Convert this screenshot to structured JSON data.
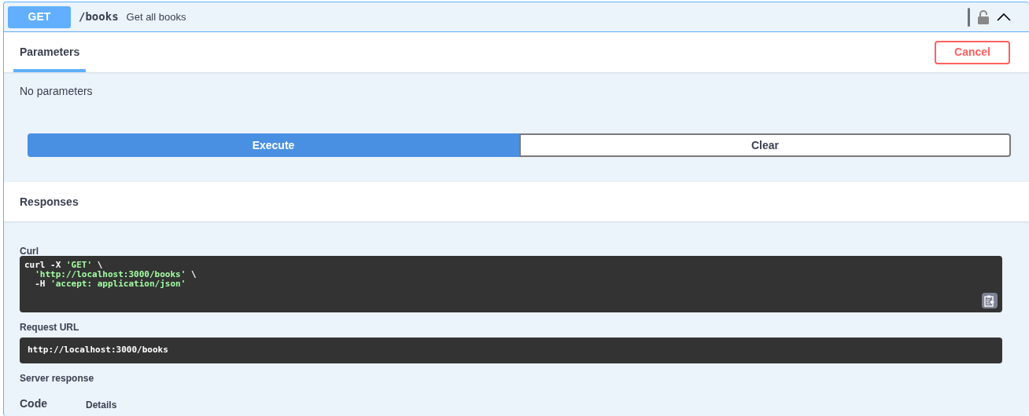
{
  "operation": {
    "method": "GET",
    "path": "/books",
    "summary": "Get all books",
    "expanded": true
  },
  "tabs": [
    {
      "label": "Parameters",
      "selected": true
    }
  ],
  "cancel_button": "Cancel",
  "parameters_message": "No parameters",
  "buttons": [
    {
      "label": "Execute",
      "kind": "primary"
    },
    {
      "label": "Clear",
      "kind": "secondary"
    }
  ],
  "responses": {
    "title": "Responses",
    "curl": {
      "label": "Curl",
      "lines": [
        [
          {
            "text": "curl -X ",
            "kind": "plain"
          },
          {
            "text": "'GET'",
            "kind": "string"
          },
          {
            "text": " \\",
            "kind": "plain"
          }
        ],
        [
          {
            "text": "  'http://localhost:3000/books'",
            "kind": "string"
          },
          {
            "text": " \\",
            "kind": "plain"
          }
        ],
        [
          {
            "text": "  -H ",
            "kind": "plain"
          },
          {
            "text": "'accept: application/json'",
            "kind": "string"
          }
        ]
      ]
    },
    "request_url": {
      "label": "Request URL",
      "value": "http://localhost:3000/books"
    },
    "server_response": {
      "label": "Server response",
      "columns": [
        "Code",
        "Details"
      ]
    }
  }
}
